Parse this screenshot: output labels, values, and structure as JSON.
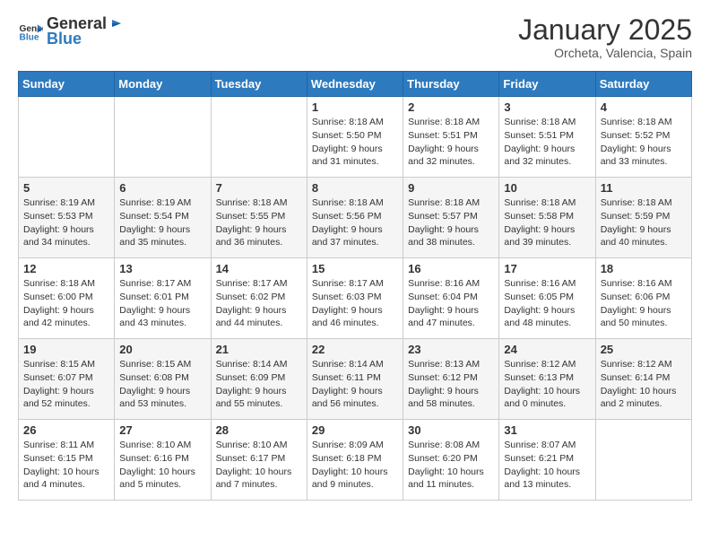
{
  "logo": {
    "general": "General",
    "blue": "Blue"
  },
  "header": {
    "month": "January 2025",
    "location": "Orcheta, Valencia, Spain"
  },
  "weekdays": [
    "Sunday",
    "Monday",
    "Tuesday",
    "Wednesday",
    "Thursday",
    "Friday",
    "Saturday"
  ],
  "weeks": [
    [
      {
        "day": "",
        "info": ""
      },
      {
        "day": "",
        "info": ""
      },
      {
        "day": "",
        "info": ""
      },
      {
        "day": "1",
        "info": "Sunrise: 8:18 AM\nSunset: 5:50 PM\nDaylight: 9 hours\nand 31 minutes."
      },
      {
        "day": "2",
        "info": "Sunrise: 8:18 AM\nSunset: 5:51 PM\nDaylight: 9 hours\nand 32 minutes."
      },
      {
        "day": "3",
        "info": "Sunrise: 8:18 AM\nSunset: 5:51 PM\nDaylight: 9 hours\nand 32 minutes."
      },
      {
        "day": "4",
        "info": "Sunrise: 8:18 AM\nSunset: 5:52 PM\nDaylight: 9 hours\nand 33 minutes."
      }
    ],
    [
      {
        "day": "5",
        "info": "Sunrise: 8:19 AM\nSunset: 5:53 PM\nDaylight: 9 hours\nand 34 minutes."
      },
      {
        "day": "6",
        "info": "Sunrise: 8:19 AM\nSunset: 5:54 PM\nDaylight: 9 hours\nand 35 minutes."
      },
      {
        "day": "7",
        "info": "Sunrise: 8:18 AM\nSunset: 5:55 PM\nDaylight: 9 hours\nand 36 minutes."
      },
      {
        "day": "8",
        "info": "Sunrise: 8:18 AM\nSunset: 5:56 PM\nDaylight: 9 hours\nand 37 minutes."
      },
      {
        "day": "9",
        "info": "Sunrise: 8:18 AM\nSunset: 5:57 PM\nDaylight: 9 hours\nand 38 minutes."
      },
      {
        "day": "10",
        "info": "Sunrise: 8:18 AM\nSunset: 5:58 PM\nDaylight: 9 hours\nand 39 minutes."
      },
      {
        "day": "11",
        "info": "Sunrise: 8:18 AM\nSunset: 5:59 PM\nDaylight: 9 hours\nand 40 minutes."
      }
    ],
    [
      {
        "day": "12",
        "info": "Sunrise: 8:18 AM\nSunset: 6:00 PM\nDaylight: 9 hours\nand 42 minutes."
      },
      {
        "day": "13",
        "info": "Sunrise: 8:17 AM\nSunset: 6:01 PM\nDaylight: 9 hours\nand 43 minutes."
      },
      {
        "day": "14",
        "info": "Sunrise: 8:17 AM\nSunset: 6:02 PM\nDaylight: 9 hours\nand 44 minutes."
      },
      {
        "day": "15",
        "info": "Sunrise: 8:17 AM\nSunset: 6:03 PM\nDaylight: 9 hours\nand 46 minutes."
      },
      {
        "day": "16",
        "info": "Sunrise: 8:16 AM\nSunset: 6:04 PM\nDaylight: 9 hours\nand 47 minutes."
      },
      {
        "day": "17",
        "info": "Sunrise: 8:16 AM\nSunset: 6:05 PM\nDaylight: 9 hours\nand 48 minutes."
      },
      {
        "day": "18",
        "info": "Sunrise: 8:16 AM\nSunset: 6:06 PM\nDaylight: 9 hours\nand 50 minutes."
      }
    ],
    [
      {
        "day": "19",
        "info": "Sunrise: 8:15 AM\nSunset: 6:07 PM\nDaylight: 9 hours\nand 52 minutes."
      },
      {
        "day": "20",
        "info": "Sunrise: 8:15 AM\nSunset: 6:08 PM\nDaylight: 9 hours\nand 53 minutes."
      },
      {
        "day": "21",
        "info": "Sunrise: 8:14 AM\nSunset: 6:09 PM\nDaylight: 9 hours\nand 55 minutes."
      },
      {
        "day": "22",
        "info": "Sunrise: 8:14 AM\nSunset: 6:11 PM\nDaylight: 9 hours\nand 56 minutes."
      },
      {
        "day": "23",
        "info": "Sunrise: 8:13 AM\nSunset: 6:12 PM\nDaylight: 9 hours\nand 58 minutes."
      },
      {
        "day": "24",
        "info": "Sunrise: 8:12 AM\nSunset: 6:13 PM\nDaylight: 10 hours\nand 0 minutes."
      },
      {
        "day": "25",
        "info": "Sunrise: 8:12 AM\nSunset: 6:14 PM\nDaylight: 10 hours\nand 2 minutes."
      }
    ],
    [
      {
        "day": "26",
        "info": "Sunrise: 8:11 AM\nSunset: 6:15 PM\nDaylight: 10 hours\nand 4 minutes."
      },
      {
        "day": "27",
        "info": "Sunrise: 8:10 AM\nSunset: 6:16 PM\nDaylight: 10 hours\nand 5 minutes."
      },
      {
        "day": "28",
        "info": "Sunrise: 8:10 AM\nSunset: 6:17 PM\nDaylight: 10 hours\nand 7 minutes."
      },
      {
        "day": "29",
        "info": "Sunrise: 8:09 AM\nSunset: 6:18 PM\nDaylight: 10 hours\nand 9 minutes."
      },
      {
        "day": "30",
        "info": "Sunrise: 8:08 AM\nSunset: 6:20 PM\nDaylight: 10 hours\nand 11 minutes."
      },
      {
        "day": "31",
        "info": "Sunrise: 8:07 AM\nSunset: 6:21 PM\nDaylight: 10 hours\nand 13 minutes."
      },
      {
        "day": "",
        "info": ""
      }
    ]
  ]
}
